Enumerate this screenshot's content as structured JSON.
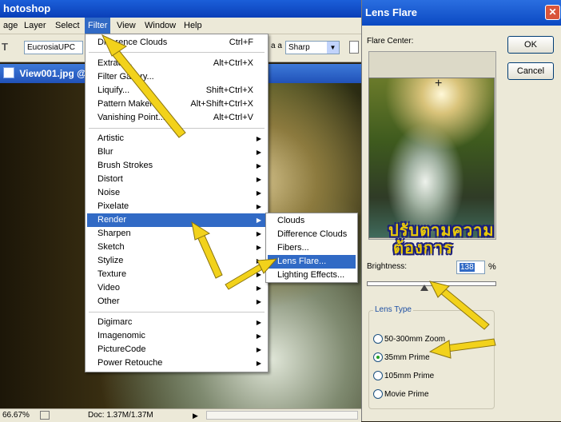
{
  "app": {
    "title": "hotoshop"
  },
  "menubar": {
    "items": [
      "age",
      "Layer",
      "Select",
      "Filter",
      "View",
      "Window",
      "Help"
    ],
    "active": "Filter"
  },
  "options_bar": {
    "tool_glyph": "T",
    "font_field": "EucrosiaUPC",
    "aa_label": "a a",
    "antialias_value": "Sharp"
  },
  "document": {
    "title": "View001.jpg @",
    "zoom": "66.67%",
    "doc_info": "Doc: 1.37M/1.37M"
  },
  "filter_menu": {
    "last_filter": {
      "label": "Difference Clouds",
      "shortcut": "Ctrl+F"
    },
    "group1": [
      {
        "label": "Extract...",
        "shortcut": "Alt+Ctrl+X"
      },
      {
        "label": "Filter Gallery...",
        "shortcut": ""
      },
      {
        "label": "Liquify...",
        "shortcut": "Shift+Ctrl+X"
      },
      {
        "label": "Pattern Maker...",
        "shortcut": "Alt+Shift+Ctrl+X"
      },
      {
        "label": "Vanishing Point...",
        "shortcut": "Alt+Ctrl+V"
      }
    ],
    "group2": [
      "Artistic",
      "Blur",
      "Brush Strokes",
      "Distort",
      "Noise",
      "Pixelate",
      "Render",
      "Sharpen",
      "Sketch",
      "Stylize",
      "Texture",
      "Video",
      "Other"
    ],
    "highlighted": "Render",
    "group3": [
      "Digimarc",
      "Imagenomic",
      "PictureCode",
      "Power Retouche"
    ]
  },
  "render_submenu": {
    "items": [
      "Clouds",
      "Difference Clouds",
      "Fibers...",
      "Lens Flare...",
      "Lighting Effects..."
    ],
    "highlighted": "Lens Flare..."
  },
  "lens_flare_dialog": {
    "title": "Lens Flare",
    "ok_label": "OK",
    "cancel_label": "Cancel",
    "flare_center_label": "Flare Center:",
    "thai_line1": "ปรับตามความ",
    "thai_line2": "ต้องการ",
    "brightness_label": "Brightness:",
    "brightness_value": "138",
    "brightness_unit": "%",
    "brightness_level": 138,
    "lens_type_label": "Lens Type",
    "lens_types": [
      "50-300mm Zoom",
      "35mm Prime",
      "105mm Prime",
      "Movie Prime"
    ],
    "selected_lens": "35mm Prime"
  },
  "colors": {
    "menu_highlight": "#316ac5",
    "annotation_arrow": "#f2d21b"
  }
}
